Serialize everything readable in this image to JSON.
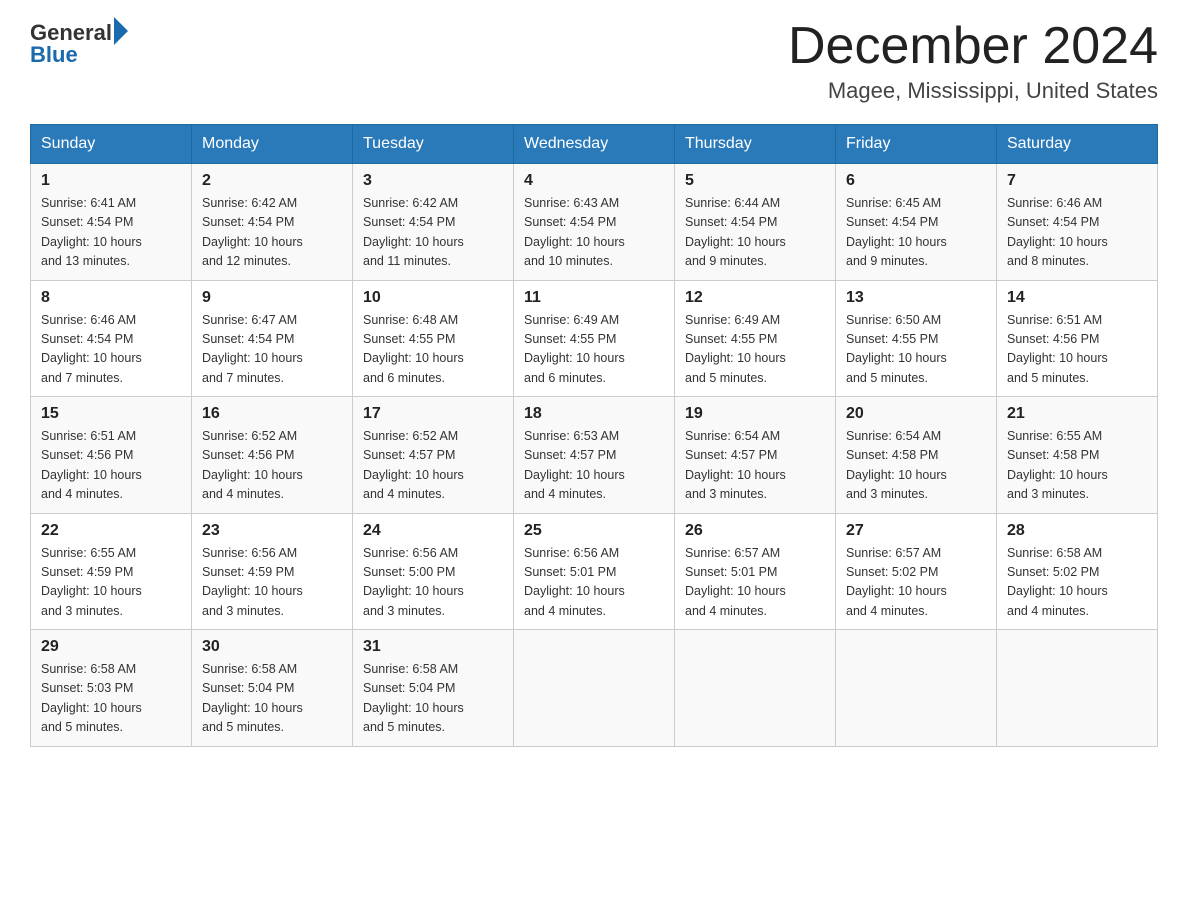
{
  "header": {
    "logo_general": "General",
    "logo_blue": "Blue",
    "title": "December 2024",
    "location": "Magee, Mississippi, United States"
  },
  "days_of_week": [
    "Sunday",
    "Monday",
    "Tuesday",
    "Wednesday",
    "Thursday",
    "Friday",
    "Saturday"
  ],
  "weeks": [
    [
      {
        "day": "1",
        "sunrise": "6:41 AM",
        "sunset": "4:54 PM",
        "daylight": "10 hours and 13 minutes."
      },
      {
        "day": "2",
        "sunrise": "6:42 AM",
        "sunset": "4:54 PM",
        "daylight": "10 hours and 12 minutes."
      },
      {
        "day": "3",
        "sunrise": "6:42 AM",
        "sunset": "4:54 PM",
        "daylight": "10 hours and 11 minutes."
      },
      {
        "day": "4",
        "sunrise": "6:43 AM",
        "sunset": "4:54 PM",
        "daylight": "10 hours and 10 minutes."
      },
      {
        "day": "5",
        "sunrise": "6:44 AM",
        "sunset": "4:54 PM",
        "daylight": "10 hours and 9 minutes."
      },
      {
        "day": "6",
        "sunrise": "6:45 AM",
        "sunset": "4:54 PM",
        "daylight": "10 hours and 9 minutes."
      },
      {
        "day": "7",
        "sunrise": "6:46 AM",
        "sunset": "4:54 PM",
        "daylight": "10 hours and 8 minutes."
      }
    ],
    [
      {
        "day": "8",
        "sunrise": "6:46 AM",
        "sunset": "4:54 PM",
        "daylight": "10 hours and 7 minutes."
      },
      {
        "day": "9",
        "sunrise": "6:47 AM",
        "sunset": "4:54 PM",
        "daylight": "10 hours and 7 minutes."
      },
      {
        "day": "10",
        "sunrise": "6:48 AM",
        "sunset": "4:55 PM",
        "daylight": "10 hours and 6 minutes."
      },
      {
        "day": "11",
        "sunrise": "6:49 AM",
        "sunset": "4:55 PM",
        "daylight": "10 hours and 6 minutes."
      },
      {
        "day": "12",
        "sunrise": "6:49 AM",
        "sunset": "4:55 PM",
        "daylight": "10 hours and 5 minutes."
      },
      {
        "day": "13",
        "sunrise": "6:50 AM",
        "sunset": "4:55 PM",
        "daylight": "10 hours and 5 minutes."
      },
      {
        "day": "14",
        "sunrise": "6:51 AM",
        "sunset": "4:56 PM",
        "daylight": "10 hours and 5 minutes."
      }
    ],
    [
      {
        "day": "15",
        "sunrise": "6:51 AM",
        "sunset": "4:56 PM",
        "daylight": "10 hours and 4 minutes."
      },
      {
        "day": "16",
        "sunrise": "6:52 AM",
        "sunset": "4:56 PM",
        "daylight": "10 hours and 4 minutes."
      },
      {
        "day": "17",
        "sunrise": "6:52 AM",
        "sunset": "4:57 PM",
        "daylight": "10 hours and 4 minutes."
      },
      {
        "day": "18",
        "sunrise": "6:53 AM",
        "sunset": "4:57 PM",
        "daylight": "10 hours and 4 minutes."
      },
      {
        "day": "19",
        "sunrise": "6:54 AM",
        "sunset": "4:57 PM",
        "daylight": "10 hours and 3 minutes."
      },
      {
        "day": "20",
        "sunrise": "6:54 AM",
        "sunset": "4:58 PM",
        "daylight": "10 hours and 3 minutes."
      },
      {
        "day": "21",
        "sunrise": "6:55 AM",
        "sunset": "4:58 PM",
        "daylight": "10 hours and 3 minutes."
      }
    ],
    [
      {
        "day": "22",
        "sunrise": "6:55 AM",
        "sunset": "4:59 PM",
        "daylight": "10 hours and 3 minutes."
      },
      {
        "day": "23",
        "sunrise": "6:56 AM",
        "sunset": "4:59 PM",
        "daylight": "10 hours and 3 minutes."
      },
      {
        "day": "24",
        "sunrise": "6:56 AM",
        "sunset": "5:00 PM",
        "daylight": "10 hours and 3 minutes."
      },
      {
        "day": "25",
        "sunrise": "6:56 AM",
        "sunset": "5:01 PM",
        "daylight": "10 hours and 4 minutes."
      },
      {
        "day": "26",
        "sunrise": "6:57 AM",
        "sunset": "5:01 PM",
        "daylight": "10 hours and 4 minutes."
      },
      {
        "day": "27",
        "sunrise": "6:57 AM",
        "sunset": "5:02 PM",
        "daylight": "10 hours and 4 minutes."
      },
      {
        "day": "28",
        "sunrise": "6:58 AM",
        "sunset": "5:02 PM",
        "daylight": "10 hours and 4 minutes."
      }
    ],
    [
      {
        "day": "29",
        "sunrise": "6:58 AM",
        "sunset": "5:03 PM",
        "daylight": "10 hours and 5 minutes."
      },
      {
        "day": "30",
        "sunrise": "6:58 AM",
        "sunset": "5:04 PM",
        "daylight": "10 hours and 5 minutes."
      },
      {
        "day": "31",
        "sunrise": "6:58 AM",
        "sunset": "5:04 PM",
        "daylight": "10 hours and 5 minutes."
      },
      null,
      null,
      null,
      null
    ]
  ],
  "labels": {
    "sunrise": "Sunrise:",
    "sunset": "Sunset:",
    "daylight": "Daylight:"
  }
}
